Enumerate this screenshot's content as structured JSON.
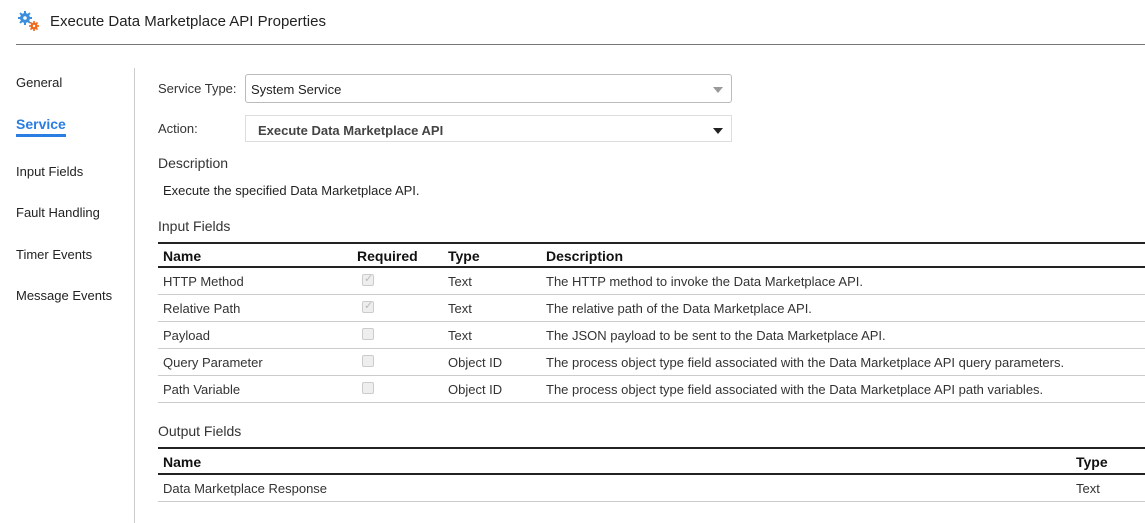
{
  "header": {
    "title": "Execute Data Marketplace API Properties",
    "icon": "gears-icon"
  },
  "sidebar": {
    "items": [
      {
        "label": "General",
        "active": false
      },
      {
        "label": "Service",
        "active": true
      },
      {
        "label": "Input Fields",
        "active": false
      },
      {
        "label": "Fault Handling",
        "active": false
      },
      {
        "label": "Timer Events",
        "active": false
      },
      {
        "label": "Message Events",
        "active": false
      }
    ]
  },
  "service": {
    "service_type_label": "Service Type:",
    "service_type_value": "System Service",
    "action_label": "Action:",
    "action_value": "Execute Data Marketplace API",
    "description_heading": "Description",
    "description_text": "Execute the specified Data Marketplace API."
  },
  "input_fields": {
    "heading": "Input Fields",
    "columns": [
      "Name",
      "Required",
      "Type",
      "Description"
    ],
    "rows": [
      {
        "name": "HTTP Method",
        "required": true,
        "type": "Text",
        "description": "The HTTP method to invoke the Data Marketplace API."
      },
      {
        "name": "Relative Path",
        "required": true,
        "type": "Text",
        "description": "The relative path of the Data Marketplace API."
      },
      {
        "name": "Payload",
        "required": false,
        "type": "Text",
        "description": "The JSON payload to be sent to the Data Marketplace API."
      },
      {
        "name": "Query Parameter",
        "required": false,
        "type": "Object ID",
        "description": "The process object type field associated with the Data Marketplace API query parameters."
      },
      {
        "name": "Path Variable",
        "required": false,
        "type": "Object ID",
        "description": "The process object type field associated with the Data Marketplace API path variables."
      }
    ]
  },
  "output_fields": {
    "heading": "Output Fields",
    "columns": [
      "Name",
      "Type"
    ],
    "rows": [
      {
        "name": "Data Marketplace Response",
        "type": "Text"
      }
    ]
  }
}
